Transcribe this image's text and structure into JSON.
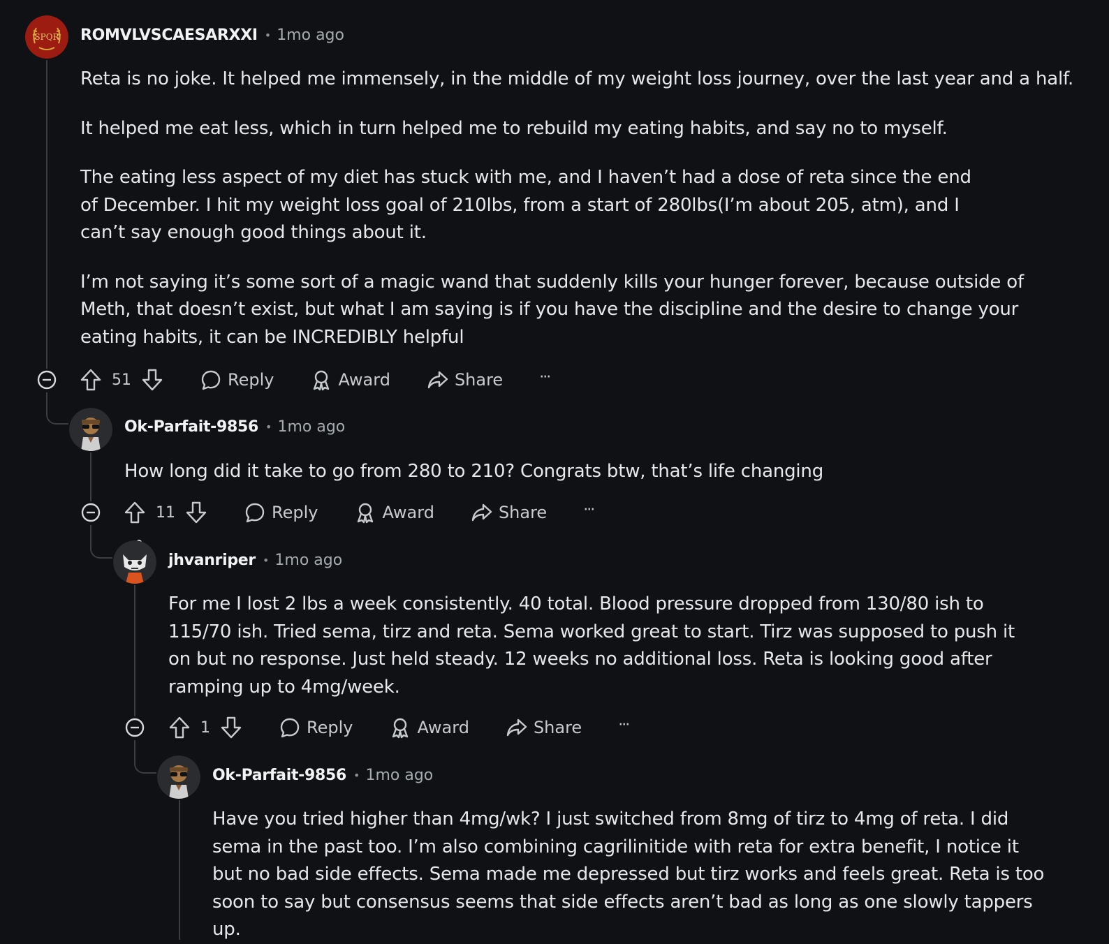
{
  "comments": [
    {
      "username": "ROMVLVSCAESARXXI",
      "time": "1mo ago",
      "avatar_text": "SPQR",
      "paragraphs": [
        "Reta is no joke. It helped me immensely, in the middle of my weight loss journey, over the last year and a half.",
        "It helped me eat less, which in turn helped me to rebuild my eating habits, and say no to myself.",
        "The eating less aspect of my diet has stuck with me, and I haven’t had a dose of reta since the end of December. I hit my weight loss goal of 210lbs, from a start of 280lbs(I’m about 205, atm), and I can’t say enough good things about it.",
        "I’m not saying it’s some sort of a magic wand that suddenly kills your hunger forever, because outside of Meth, that doesn’t exist, but what I am saying is if you have the discipline and the desire to change your eating habits, it can be INCREDIBLY helpful"
      ],
      "votes": "51"
    },
    {
      "username": "Ok-Parfait-9856",
      "time": "1mo ago",
      "paragraphs": [
        "How long did it take to go from 280 to 210? Congrats btw, that’s life changing"
      ],
      "votes": "11"
    },
    {
      "username": "jhvanriper",
      "time": "1mo ago",
      "paragraphs": [
        "For me I lost 2 lbs a week consistently. 40 total. Blood pressure dropped from 130/80 ish to 115/70 ish. Tried sema, tirz and reta. Sema worked great to start. Tirz was supposed to push it on but no response. Just held steady. 12 weeks no additional loss. Reta is looking good after ramping up to 4mg/week."
      ],
      "votes": "1"
    },
    {
      "username": "Ok-Parfait-9856",
      "time": "1mo ago",
      "paragraphs": [
        "Have you tried higher than 4mg/wk? I just switched from 8mg of tirz to 4mg of reta. I did sema in the past too. I’m also combining cagrilinitide with reta for extra benefit, I notice it but no bad side effects. Sema made me depressed but tirz works and feels great. Reta is too soon to say but consensus seems that side effects aren’t bad as long as one slowly tappers up."
      ]
    }
  ],
  "actions": {
    "reply": "Reply",
    "award": "Award",
    "share": "Share",
    "more": "···"
  },
  "icons": [
    "collapse-icon",
    "upvote-icon",
    "downvote-icon",
    "reply-icon",
    "award-icon",
    "share-icon",
    "more-icon"
  ],
  "colors": {
    "background": "#0f1114",
    "text": "#e6e8ea",
    "muted": "#a6abb0",
    "avatar_red": "#9c1c12"
  }
}
